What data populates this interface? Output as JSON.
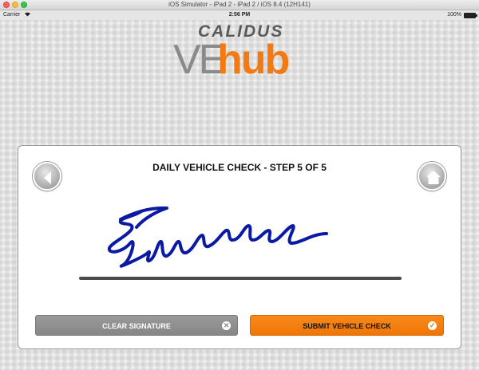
{
  "window": {
    "title": "iOS Simulator - iPad 2 - iPad 2 / iOS 8.4 (12H141)"
  },
  "statusbar": {
    "carrier": "Carrier",
    "time": "2:56 PM",
    "battery": "100%"
  },
  "logo": {
    "top": "CALIDUS",
    "left": "VE",
    "right": "hub",
    "accent_color": "#f37a12"
  },
  "card": {
    "title": "DAILY VEHICLE CHECK - STEP 5 OF 5",
    "back_icon": "back-arrow-icon",
    "home_icon": "home-icon"
  },
  "actions": {
    "clear_label": "CLEAR SIGNATURE",
    "clear_icon": "close-icon",
    "submit_label": "SUBMIT VEHICLE CHECK",
    "submit_icon": "checkmark-icon",
    "submit_color": "#ef7606"
  }
}
